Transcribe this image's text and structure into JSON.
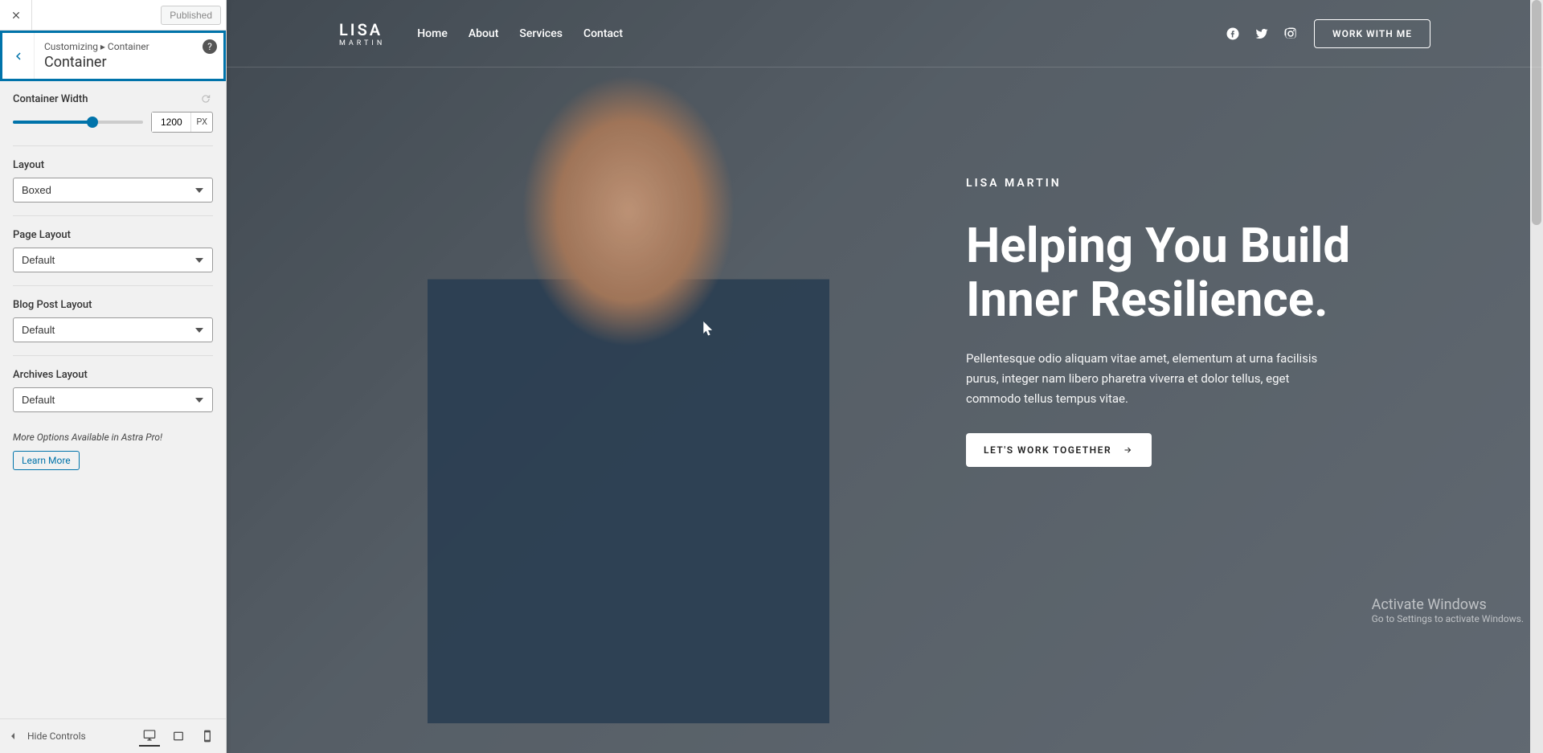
{
  "sidebar": {
    "publish_label": "Published",
    "breadcrumb": "Customizing  ▸  Container",
    "section_title": "Container",
    "controls": {
      "width_label": "Container Width",
      "width_value": "1200",
      "width_unit": "PX",
      "layout_label": "Layout",
      "layout_value": "Boxed",
      "page_layout_label": "Page Layout",
      "page_layout_value": "Default",
      "blog_layout_label": "Blog Post Layout",
      "blog_layout_value": "Default",
      "archives_layout_label": "Archives Layout",
      "archives_layout_value": "Default"
    },
    "pro_note": "More Options Available in Astra Pro!",
    "learn_more": "Learn More",
    "hide_controls": "Hide Controls"
  },
  "preview": {
    "logo_main": "LISA",
    "logo_sub": "MARTIN",
    "nav": {
      "home": "Home",
      "about": "About",
      "services": "Services",
      "contact": "Contact"
    },
    "work_with_me": "WORK WITH ME",
    "eyebrow": "LISA MARTIN",
    "headline": "Helping You Build Inner Resilience.",
    "body": "Pellentesque odio aliquam vitae amet, elementum at urna facilisis purus, integer nam libero pharetra viverra et dolor tellus, eget commodo tellus tempus vitae.",
    "cta": "LET'S WORK TOGETHER"
  },
  "activate": {
    "title": "Activate Windows",
    "sub": "Go to Settings to activate Windows."
  }
}
